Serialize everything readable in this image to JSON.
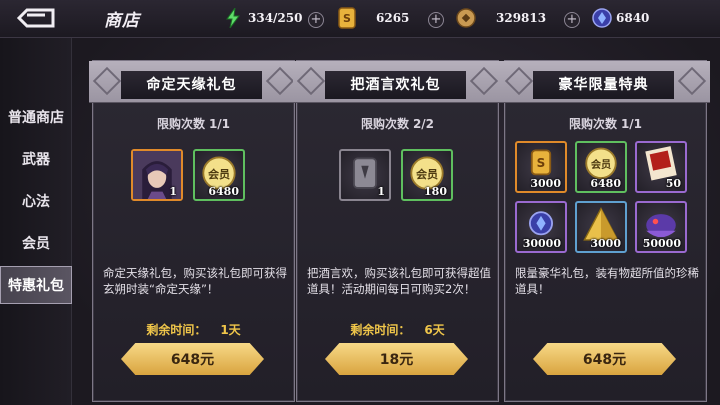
{
  "header": {
    "title": "商店",
    "resources": [
      {
        "icon": "energy-icon",
        "value": "334/250"
      },
      {
        "icon": "gold-ingot-icon",
        "value": "6265"
      },
      {
        "icon": "copper-coin-icon",
        "value": "329813"
      },
      {
        "icon": "blue-gem-icon",
        "value": "6840"
      }
    ]
  },
  "sidebar": {
    "items": [
      {
        "label": "普通商店"
      },
      {
        "label": "武器"
      },
      {
        "label": "心法"
      },
      {
        "label": "会员"
      },
      {
        "label": "特惠礼包",
        "active": true
      }
    ]
  },
  "packs": [
    {
      "title": "命定天缘礼包",
      "limit_label": "限购次数",
      "limit_value": "1/1",
      "items": [
        {
          "icon": "hero-portrait-icon",
          "count": "1"
        },
        {
          "icon": "vip-coin-icon",
          "count": "6480"
        }
      ],
      "description": "命定天缘礼包，购买该礼包即可获得玄朔时装“命定天缘”！",
      "remain_label": "剩余时间：",
      "remain_value": "1天",
      "price": "648元"
    },
    {
      "title": "把酒言欢礼包",
      "limit_label": "限购次数",
      "limit_value": "2/2",
      "items": [
        {
          "icon": "grey-token-icon",
          "count": "1"
        },
        {
          "icon": "vip-coin-icon",
          "count": "180"
        }
      ],
      "description": "把酒言欢，购买该礼包即可获得超值道具！活动期间每日可购买2次！",
      "remain_label": "剩余时间：",
      "remain_value": "6天",
      "price": "18元"
    },
    {
      "title": "豪华限量特典",
      "limit_label": "限购次数",
      "limit_value": "1/1",
      "items": [
        {
          "icon": "gold-ingot-icon",
          "count": "3000"
        },
        {
          "icon": "vip-coin-icon",
          "count": "6480"
        },
        {
          "icon": "red-scroll-icon",
          "count": "50"
        },
        {
          "icon": "blue-gem-icon",
          "count": "30000"
        },
        {
          "icon": "gold-pyramid-icon",
          "count": "3000"
        },
        {
          "icon": "purple-beast-icon",
          "count": "50000"
        }
      ],
      "description": "限量豪华礼包，装有物超所值的珍稀道具！",
      "price": "648元"
    }
  ],
  "colors": {
    "accent_gold": "#f0c64a",
    "button_gold": "#e6b95a",
    "active_tab": "#5a5562"
  }
}
